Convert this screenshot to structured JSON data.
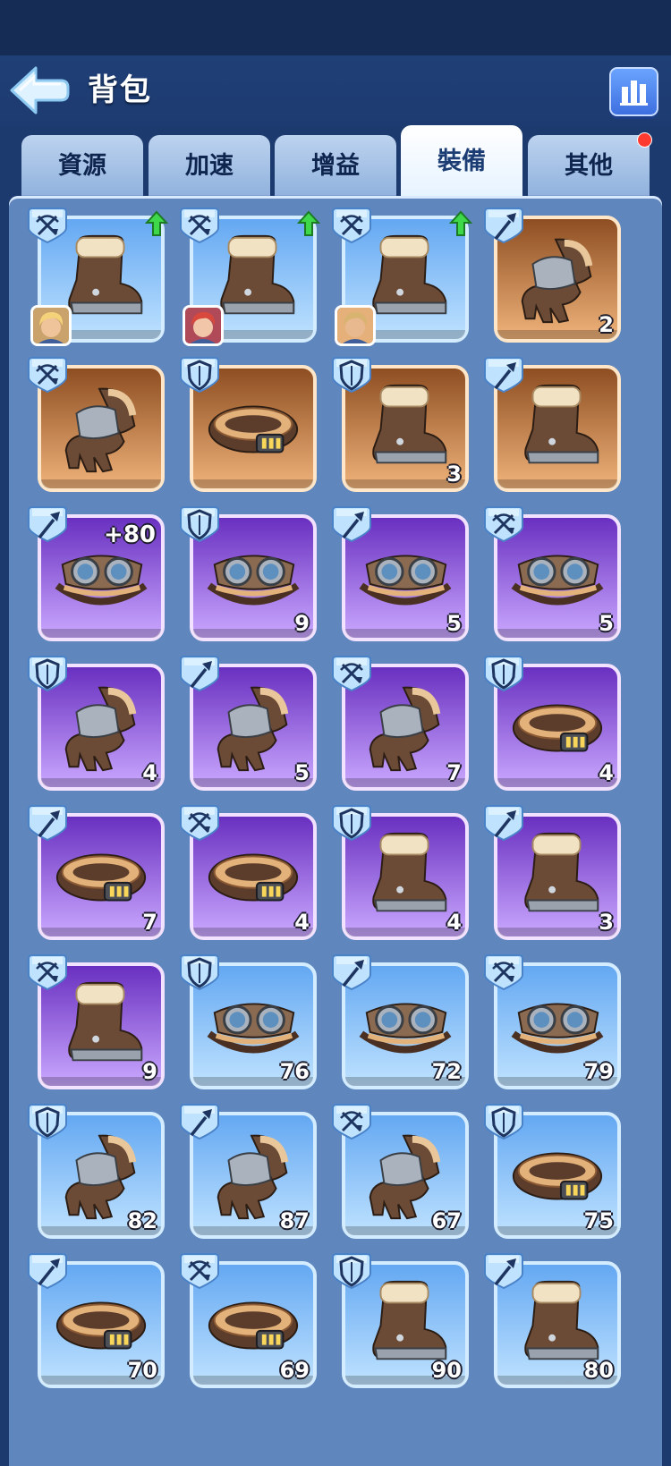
{
  "header": {
    "title": "背包"
  },
  "tabs": [
    {
      "label": "資源",
      "active": false,
      "notification": false
    },
    {
      "label": "加速",
      "active": false,
      "notification": false
    },
    {
      "label": "增益",
      "active": false,
      "notification": false
    },
    {
      "label": "裝備",
      "active": true,
      "notification": false
    },
    {
      "label": "其他",
      "active": false,
      "notification": true
    }
  ],
  "colors": {
    "blue": "#64a8f2",
    "orange": "#d98a4a",
    "purple": "#8a52e0",
    "accent": "#4a7df0"
  },
  "items": [
    {
      "slot": "boots",
      "rarity": "blue",
      "type": "crossbow",
      "count": "",
      "upgrade": true,
      "hero": "hero-blonde"
    },
    {
      "slot": "boots",
      "rarity": "blue",
      "type": "crossbow",
      "count": "",
      "upgrade": true,
      "hero": "hero-redhair"
    },
    {
      "slot": "boots",
      "rarity": "blue",
      "type": "crossbow",
      "count": "",
      "upgrade": true,
      "hero": "hero-bearded"
    },
    {
      "slot": "gloves",
      "rarity": "orange",
      "type": "spear",
      "count": "2"
    },
    {
      "slot": "gloves",
      "rarity": "orange",
      "type": "crossbow",
      "count": ""
    },
    {
      "slot": "belt",
      "rarity": "orange",
      "type": "shield",
      "count": ""
    },
    {
      "slot": "boots",
      "rarity": "orange",
      "type": "shield",
      "count": "3"
    },
    {
      "slot": "boots",
      "rarity": "orange",
      "type": "spear",
      "count": ""
    },
    {
      "slot": "goggles",
      "rarity": "purple",
      "type": "spear",
      "count": "",
      "plus": "+80"
    },
    {
      "slot": "goggles",
      "rarity": "purple",
      "type": "shield",
      "count": "9"
    },
    {
      "slot": "goggles",
      "rarity": "purple",
      "type": "spear",
      "count": "5"
    },
    {
      "slot": "goggles",
      "rarity": "purple",
      "type": "crossbow",
      "count": "5"
    },
    {
      "slot": "gloves",
      "rarity": "purple",
      "type": "shield",
      "count": "4"
    },
    {
      "slot": "gloves",
      "rarity": "purple",
      "type": "spear",
      "count": "5"
    },
    {
      "slot": "gloves",
      "rarity": "purple",
      "type": "crossbow",
      "count": "7"
    },
    {
      "slot": "belt",
      "rarity": "purple",
      "type": "shield",
      "count": "4"
    },
    {
      "slot": "belt",
      "rarity": "purple",
      "type": "spear",
      "count": "7"
    },
    {
      "slot": "belt",
      "rarity": "purple",
      "type": "crossbow",
      "count": "4"
    },
    {
      "slot": "boots",
      "rarity": "purple",
      "type": "shield",
      "count": "4"
    },
    {
      "slot": "boots",
      "rarity": "purple",
      "type": "spear",
      "count": "3"
    },
    {
      "slot": "boots",
      "rarity": "purple",
      "type": "crossbow",
      "count": "9"
    },
    {
      "slot": "goggles",
      "rarity": "blue",
      "type": "shield",
      "count": "76"
    },
    {
      "slot": "goggles",
      "rarity": "blue",
      "type": "spear",
      "count": "72"
    },
    {
      "slot": "goggles",
      "rarity": "blue",
      "type": "crossbow",
      "count": "79"
    },
    {
      "slot": "gloves",
      "rarity": "blue",
      "type": "shield",
      "count": "82"
    },
    {
      "slot": "gloves",
      "rarity": "blue",
      "type": "spear",
      "count": "87"
    },
    {
      "slot": "gloves",
      "rarity": "blue",
      "type": "crossbow",
      "count": "67"
    },
    {
      "slot": "belt",
      "rarity": "blue",
      "type": "shield",
      "count": "75"
    },
    {
      "slot": "belt",
      "rarity": "blue",
      "type": "spear",
      "count": "70"
    },
    {
      "slot": "belt",
      "rarity": "blue",
      "type": "crossbow",
      "count": "69"
    },
    {
      "slot": "boots",
      "rarity": "blue",
      "type": "shield",
      "count": "90"
    },
    {
      "slot": "boots",
      "rarity": "blue",
      "type": "spear",
      "count": "80"
    }
  ]
}
